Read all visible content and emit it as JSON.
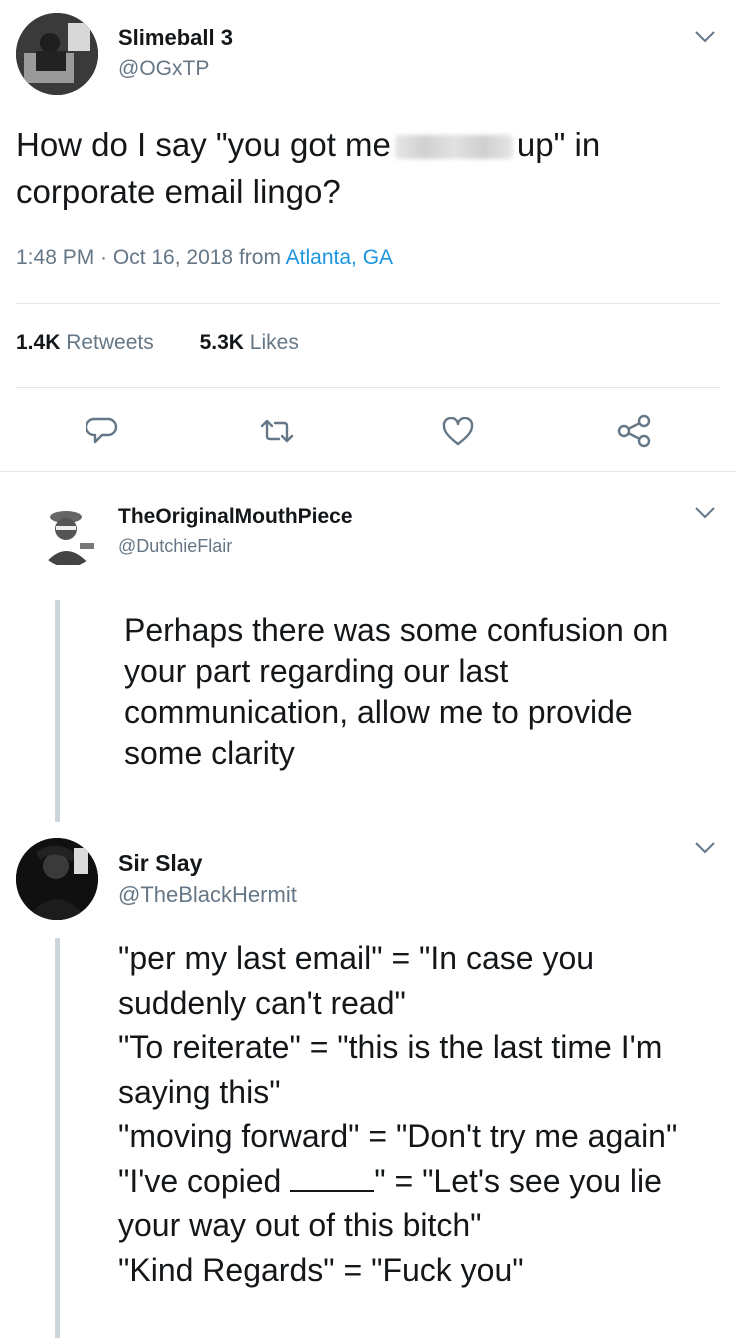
{
  "tweet": {
    "author_name": "Slimeball 3",
    "author_handle": "@OGxTP",
    "text_before": "How do I say \"you got me",
    "text_after": "up\" in",
    "text_line2": "corporate email lingo?",
    "time": "1:48 PM · Oct 16, 2018 from",
    "location": "Atlanta, GA",
    "retweets_count": "1.4K",
    "retweets_label": "Retweets",
    "likes_count": "5.3K",
    "likes_label": "Likes"
  },
  "reply1": {
    "author_name": "TheOriginalMouthPiece",
    "author_handle": "@DutchieFlair",
    "lines": [
      "Perhaps there was some confusion on",
      "your part regarding our last",
      "communication, allow me to provide",
      "some clarity"
    ]
  },
  "reply2": {
    "author_name": "Sir Slay",
    "author_handle": "@TheBlackHermit",
    "lines": [
      "\"per my last email\" = \"In case you",
      "suddenly can't read\"",
      "\"To reiterate\" = \"this is the last time I'm",
      "saying this\"",
      "\"moving forward\" = \"Don't try me again\"",
      "\"I've copied",
      "\" = \"Let's see you lie",
      "your way out of this bitch\"",
      "\"Kind Regards\" = \"Fuck you\""
    ]
  },
  "icons": {
    "actions": [
      "reply-icon",
      "retweet-icon",
      "like-icon",
      "share-icon"
    ],
    "menu": "chevron-down-icon"
  },
  "colors": {
    "link": "#1b95e0",
    "muted": "#657786",
    "icon": "#657786",
    "divider": "#e1e8ed"
  }
}
